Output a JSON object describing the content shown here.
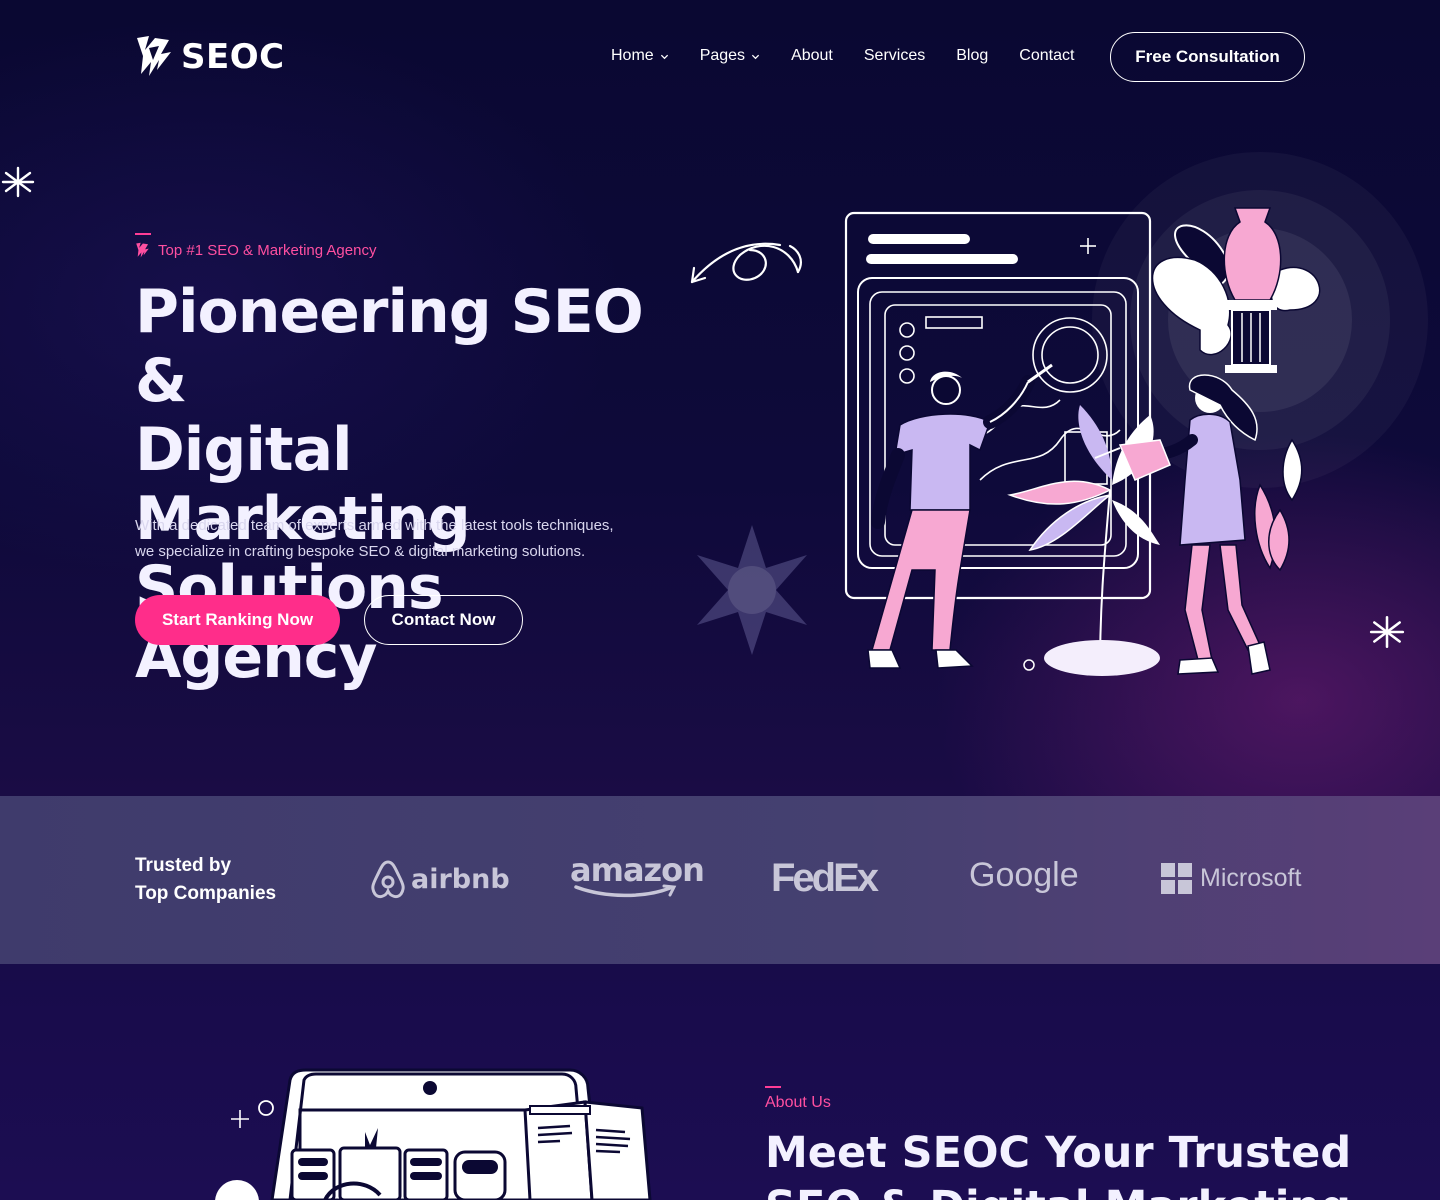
{
  "brand": {
    "name": "SEOC"
  },
  "nav": {
    "items": [
      {
        "label": "Home",
        "has_dropdown": true
      },
      {
        "label": "Pages",
        "has_dropdown": true
      },
      {
        "label": "About",
        "has_dropdown": false
      },
      {
        "label": "Services",
        "has_dropdown": false
      },
      {
        "label": "Blog",
        "has_dropdown": false
      },
      {
        "label": "Contact",
        "has_dropdown": false
      }
    ],
    "cta_label": "Free Consultation"
  },
  "hero": {
    "tagline": "Top #1 SEO & Marketing Agency",
    "title_lines": [
      "Pioneering SEO &",
      "Digital Marketing",
      "Solutions Agency"
    ],
    "description_lines": [
      "With a dedicated team of experts armed with the latest tools  techniques,",
      "we specialize in crafting bespoke SEO & digital marketing solutions."
    ],
    "primary_button": "Start Ranking Now",
    "secondary_button": "Contact Now"
  },
  "trusted": {
    "title_lines": [
      "Trusted by",
      "Top Companies"
    ],
    "brands": [
      "airbnb",
      "amazon",
      "FedEx",
      "Google",
      "Microsoft"
    ]
  },
  "about": {
    "tag": "About Us",
    "title_lines": [
      "Meet SEOC Your Trusted",
      "SEO & Digital Marketing"
    ]
  },
  "colors": {
    "accent": "#ff2d8a",
    "accent_text": "#ff4fa0",
    "background": "#0b0833",
    "band": "#443f6e",
    "illustration_pink": "#f7a8d2",
    "illustration_lavender": "#c9b8f2"
  }
}
